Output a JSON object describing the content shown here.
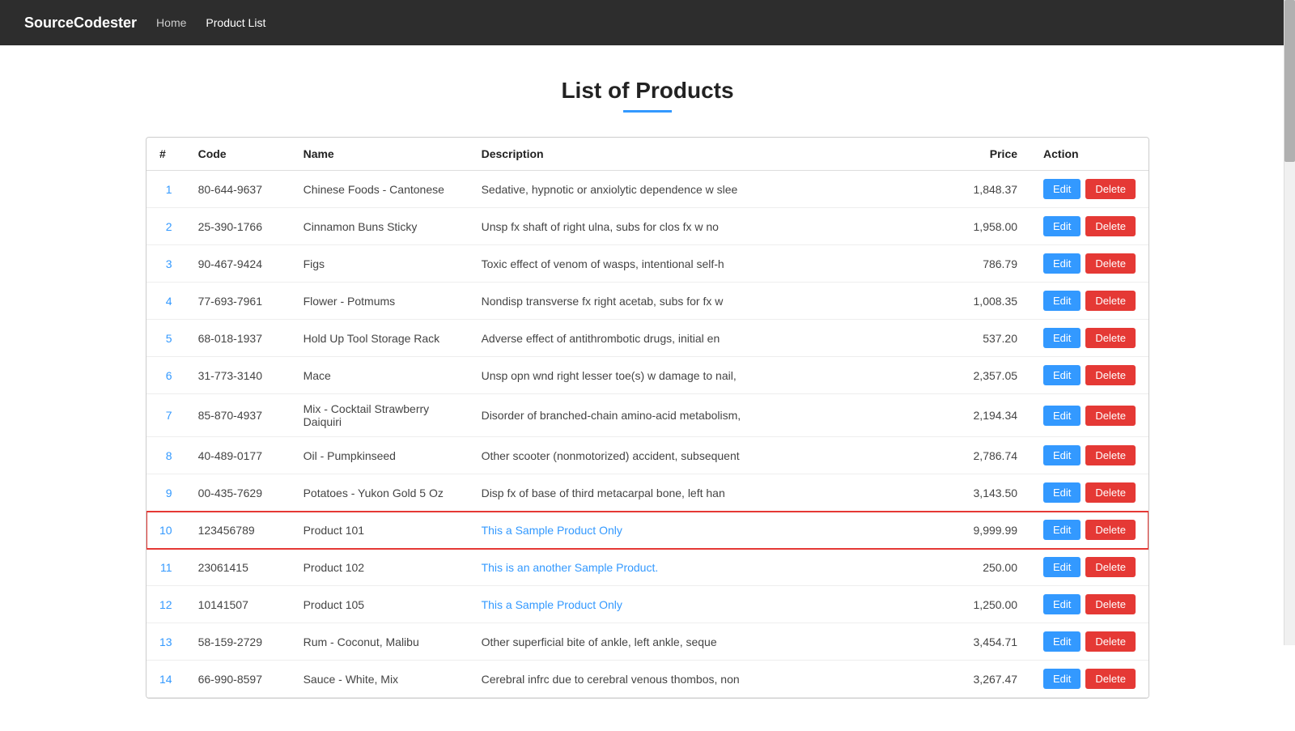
{
  "navbar": {
    "brand": "SourceCodester",
    "links": [
      {
        "label": "Home",
        "active": false
      },
      {
        "label": "Product List",
        "active": true
      }
    ]
  },
  "page": {
    "title": "List of Products"
  },
  "table": {
    "columns": [
      "#",
      "Code",
      "Name",
      "Description",
      "Price",
      "Action"
    ],
    "rows": [
      {
        "id": 1,
        "code": "80-644-9637",
        "name": "Chinese Foods - Cantonese",
        "description": "Sedative, hypnotic or anxiolytic dependence w slee",
        "price": "1,848.37",
        "desc_blue": false,
        "highlighted": false
      },
      {
        "id": 2,
        "code": "25-390-1766",
        "name": "Cinnamon Buns Sticky",
        "description": "Unsp fx shaft of right ulna, subs for clos fx w no",
        "price": "1,958.00",
        "desc_blue": false,
        "highlighted": false
      },
      {
        "id": 3,
        "code": "90-467-9424",
        "name": "Figs",
        "description": "Toxic effect of venom of wasps, intentional self-h",
        "price": "786.79",
        "desc_blue": false,
        "highlighted": false
      },
      {
        "id": 4,
        "code": "77-693-7961",
        "name": "Flower - Potmums",
        "description": "Nondisp transverse fx right acetab, subs for fx w",
        "price": "1,008.35",
        "desc_blue": false,
        "highlighted": false
      },
      {
        "id": 5,
        "code": "68-018-1937",
        "name": "Hold Up Tool Storage Rack",
        "description": "Adverse effect of antithrombotic drugs, initial en",
        "price": "537.20",
        "desc_blue": false,
        "highlighted": false
      },
      {
        "id": 6,
        "code": "31-773-3140",
        "name": "Mace",
        "description": "Unsp opn wnd right lesser toe(s) w damage to nail,",
        "price": "2,357.05",
        "desc_blue": false,
        "highlighted": false
      },
      {
        "id": 7,
        "code": "85-870-4937",
        "name": "Mix - Cocktail Strawberry Daiquiri",
        "description": "Disorder of branched-chain amino-acid metabolism,",
        "price": "2,194.34",
        "desc_blue": false,
        "highlighted": false
      },
      {
        "id": 8,
        "code": "40-489-0177",
        "name": "Oil - Pumpkinseed",
        "description": "Other scooter (nonmotorized) accident, subsequent",
        "price": "2,786.74",
        "desc_blue": false,
        "highlighted": false
      },
      {
        "id": 9,
        "code": "00-435-7629",
        "name": "Potatoes - Yukon Gold 5 Oz",
        "description": "Disp fx of base of third metacarpal bone, left han",
        "price": "3,143.50",
        "desc_blue": false,
        "highlighted": false
      },
      {
        "id": 10,
        "code": "123456789",
        "name": "Product 101",
        "description": "This a Sample Product Only",
        "price": "9,999.99",
        "desc_blue": true,
        "highlighted": true
      },
      {
        "id": 11,
        "code": "23061415",
        "name": "Product 102",
        "description": "This is an another Sample Product.",
        "price": "250.00",
        "desc_blue": true,
        "highlighted": false
      },
      {
        "id": 12,
        "code": "10141507",
        "name": "Product 105",
        "description": "This a Sample Product Only",
        "price": "1,250.00",
        "desc_blue": true,
        "highlighted": false
      },
      {
        "id": 13,
        "code": "58-159-2729",
        "name": "Rum - Coconut, Malibu",
        "description": "Other superficial bite of ankle, left ankle, seque",
        "price": "3,454.71",
        "desc_blue": false,
        "highlighted": false
      },
      {
        "id": 14,
        "code": "66-990-8597",
        "name": "Sauce - White, Mix",
        "description": "Cerebral infrc due to cerebral venous thombos, non",
        "price": "3,267.47",
        "desc_blue": false,
        "highlighted": false
      }
    ],
    "buttons": {
      "edit": "Edit",
      "delete": "Delete"
    }
  }
}
